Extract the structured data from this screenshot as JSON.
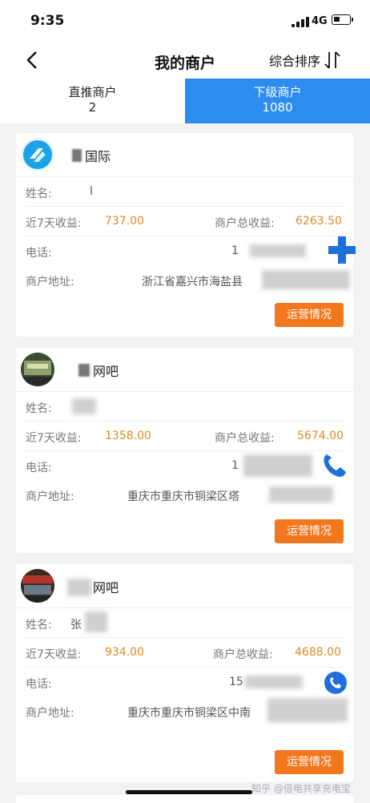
{
  "status_bar": {
    "time": "9:35",
    "network": "4G"
  },
  "nav": {
    "title": "我的商户",
    "sort_label": "综合排序"
  },
  "tabs": [
    {
      "label": "直推商户",
      "count": "2",
      "active": false
    },
    {
      "label": "下级商户",
      "count": "1080",
      "active": true
    }
  ],
  "labels": {
    "name": "姓名:",
    "income7": "近7天收益:",
    "total": "商户总收益:",
    "phone": "电话:",
    "address": "商户地址:",
    "button": "运营情况"
  },
  "merchants": [
    {
      "title": "国际",
      "contact": "l",
      "income7": "737.00",
      "total": "6263.50",
      "phone": "1",
      "address": "浙江省嘉兴市海盐县"
    },
    {
      "title": "网吧",
      "contact": "",
      "income7": "1358.00",
      "total": "5674.00",
      "phone": "1",
      "address": "重庆市重庆市铜梁区塔"
    },
    {
      "title": "网吧",
      "contact": "张",
      "income7": "934.00",
      "total": "4688.00",
      "phone": "15",
      "address": "重庆市重庆市铜梁区中南"
    }
  ],
  "watermark": "知乎 @倍电共享充电宝",
  "colors": {
    "accent": "#2d8cf0",
    "button": "#f3771c",
    "income": "#e08a1e"
  }
}
